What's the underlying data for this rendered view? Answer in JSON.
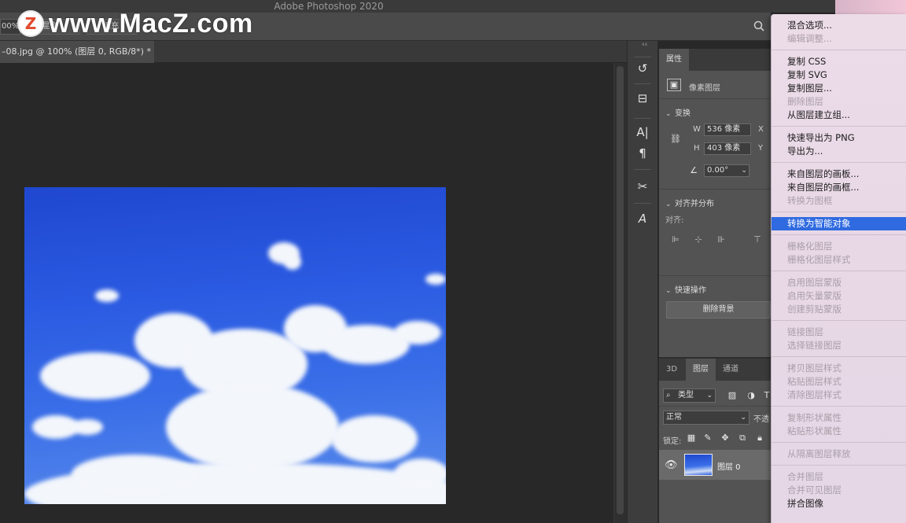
{
  "app": {
    "title": "Adobe Photoshop 2020"
  },
  "watermark": {
    "logo_letter": "Z",
    "text": "www.MacZ.com"
  },
  "options_bar": {
    "zoom_value": "00%",
    "checkbox_label": "混合",
    "button2_label": "填充"
  },
  "document": {
    "tab_label": "–08.jpg @ 100% (图层 0, RGB/8*) *"
  },
  "properties": {
    "tab_label": "属性",
    "kind": "像素图层",
    "transform": {
      "title": "变换",
      "w_label": "W",
      "w_value": "536 像素",
      "x_label": "X",
      "h_label": "H",
      "h_value": "403 像素",
      "y_label": "Y",
      "angle_value": "0.00°"
    },
    "align": {
      "title": "对齐并分布",
      "label": "对齐:"
    },
    "quick_actions": {
      "title": "快速操作",
      "remove_bg": "删除背景"
    }
  },
  "layers": {
    "tabs": [
      "3D",
      "图层",
      "通道"
    ],
    "filter_label": "类型",
    "blend_mode": "正常",
    "opacity_label": "不透",
    "lock_label": "锁定:",
    "layer_name": "图层 0"
  },
  "context_menu": {
    "groups": [
      [
        {
          "label": "混合选项...",
          "enabled": true
        },
        {
          "label": "编辑调整...",
          "enabled": false
        }
      ],
      [
        {
          "label": "复制 CSS",
          "enabled": true
        },
        {
          "label": "复制 SVG",
          "enabled": true
        },
        {
          "label": "复制图层...",
          "enabled": true
        },
        {
          "label": "删除图层",
          "enabled": false
        },
        {
          "label": "从图层建立组...",
          "enabled": true
        }
      ],
      [
        {
          "label": "快速导出为 PNG",
          "enabled": true
        },
        {
          "label": "导出为...",
          "enabled": true
        }
      ],
      [
        {
          "label": "来自图层的画板...",
          "enabled": true
        },
        {
          "label": "来自图层的画框...",
          "enabled": true
        },
        {
          "label": "转换为图框",
          "enabled": false
        }
      ],
      [
        {
          "label": "转换为智能对象",
          "enabled": true,
          "selected": true
        }
      ],
      [
        {
          "label": "栅格化图层",
          "enabled": false
        },
        {
          "label": "栅格化图层样式",
          "enabled": false
        }
      ],
      [
        {
          "label": "启用图层蒙版",
          "enabled": false
        },
        {
          "label": "启用矢量蒙版",
          "enabled": false
        },
        {
          "label": "创建剪贴蒙版",
          "enabled": false
        }
      ],
      [
        {
          "label": "链接图层",
          "enabled": false
        },
        {
          "label": "选择链接图层",
          "enabled": false
        }
      ],
      [
        {
          "label": "拷贝图层样式",
          "enabled": false
        },
        {
          "label": "粘贴图层样式",
          "enabled": false
        },
        {
          "label": "清除图层样式",
          "enabled": false
        }
      ],
      [
        {
          "label": "复制形状属性",
          "enabled": false
        },
        {
          "label": "粘贴形状属性",
          "enabled": false
        }
      ],
      [
        {
          "label": "从隔离图层释放",
          "enabled": false
        }
      ],
      [
        {
          "label": "合并图层",
          "enabled": false
        },
        {
          "label": "合并可见图层",
          "enabled": false
        },
        {
          "label": "拼合图像",
          "enabled": true
        }
      ]
    ],
    "highlight_color": "#2f6ae0"
  }
}
